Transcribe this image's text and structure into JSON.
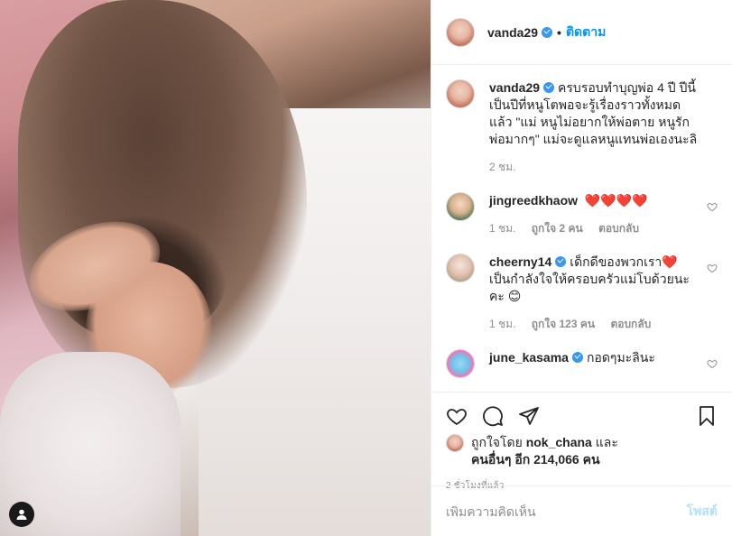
{
  "post": {
    "author": "vanda29",
    "follow_label": "ติดตาม",
    "caption_user": "vanda29",
    "caption": "ครบรอบทำบุญพ่อ 4 ปี ปีนี้เป็นปีที่หนูโตพอจะรู้เรื่องราวทั้งหมดแล้ว \"แม่ หนูไม่อยากให้พ่อตาย หนูรักพ่อมากๆ\" แม่จะดูแลหนูแทนพ่อเองนะลิ",
    "caption_time": "2 ชม."
  },
  "comments": [
    {
      "user": "jingreedkhaow",
      "text": "❤️❤️❤️❤️",
      "time": "1 ชม.",
      "likes": "ถูกใจ 2 คน",
      "reply": "ตอบกลับ",
      "verified": false
    },
    {
      "user": "cheerny14",
      "text": "เด็กดีของพวกเรา❤️ เป็นกำลังใจให้ครอบครัวแม่โบด้วยนะคะ 😊",
      "time": "1 ชม.",
      "likes": "ถูกใจ 123 คน",
      "reply": "ตอบกลับ",
      "verified": true
    },
    {
      "user": "june_kasama",
      "text": "กอดๆมะลินะ",
      "verified": true
    }
  ],
  "likes": {
    "prefix": "ถูกใจโดย",
    "user": "nok_chana",
    "and": "และ",
    "others": "คนอื่นๆ อีก 214,066 คน"
  },
  "timestamp": "2 ชั่วโมงที่แล้ว",
  "add_comment": {
    "placeholder": "เพิ่มความคิดเห็น",
    "post_label": "โพสต์"
  },
  "icons": {
    "like": "heart-outline-icon",
    "comment": "comment-icon",
    "share": "paper-plane-icon",
    "save": "bookmark-icon",
    "tag": "user-tag-icon"
  },
  "colors": {
    "link": "#0095f6",
    "verified": "#3897f0",
    "muted": "#8e8e8e",
    "post_disabled": "#b2dffc"
  }
}
